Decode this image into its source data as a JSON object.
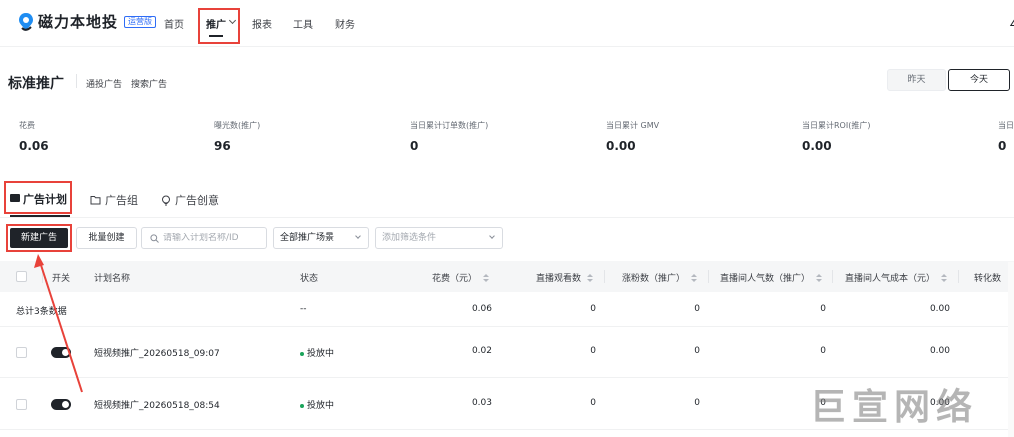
{
  "app": {
    "logo_text": "磁力本地投",
    "logo_badge": "运营版",
    "brand_color": "#1f8df2"
  },
  "nav": {
    "items": [
      {
        "label": "首页"
      },
      {
        "label": "推广",
        "active": true
      },
      {
        "label": "报表"
      },
      {
        "label": "工具"
      },
      {
        "label": "财务"
      }
    ],
    "edge_glyph": "∠"
  },
  "page": {
    "title": "标准推广",
    "sub_links": [
      "通投广告",
      "搜索广告"
    ],
    "day_buttons": {
      "yesterday": "昨天",
      "today": "今天",
      "selected": "今天"
    }
  },
  "metrics": [
    {
      "label": "花费",
      "value": "0.06"
    },
    {
      "label": "曝光数(推广)",
      "value": "96"
    },
    {
      "label": "当日累计订单数(推广)",
      "value": "0"
    },
    {
      "label": "当日累计 GMV",
      "value": "0.00"
    },
    {
      "label": "当日累计ROI(推广)",
      "value": "0.00"
    },
    {
      "label": "当日",
      "value": "0"
    }
  ],
  "tabs": [
    {
      "label": "广告计划",
      "icon": "folder-filled-icon",
      "active": true
    },
    {
      "label": "广告组",
      "icon": "folder-outline-icon"
    },
    {
      "label": "广告创意",
      "icon": "bulb-icon"
    }
  ],
  "toolbar": {
    "new_button": "新建广告",
    "batch_button": "批量创建",
    "search_placeholder": "请输入计划名称/ID",
    "scene_select": "全部推广场景",
    "filter_select_placeholder": "添加筛选条件"
  },
  "table": {
    "columns": [
      "开关",
      "计划名称",
      "状态",
      "花费（元）",
      "直播观看数",
      "涨粉数（推广）",
      "直播间人气数（推广）",
      "直播间人气成本（元）",
      "转化数"
    ],
    "summary": {
      "label": "总计3条数据",
      "status": "--",
      "spend": "0.06",
      "views": "0",
      "fans": "0",
      "popularity": "0",
      "popularity_cost": "0.00"
    },
    "rows": [
      {
        "name": "短视频推广_20260518_09:07",
        "status": "投放中",
        "spend": "0.02",
        "views": "0",
        "fans": "0",
        "popularity": "0",
        "popularity_cost": "0.00",
        "enabled": true
      },
      {
        "name": "短视频推广_20260518_08:54",
        "status": "投放中",
        "spend": "0.03",
        "views": "0",
        "fans": "0",
        "popularity": "0",
        "popularity_cost": "0.00",
        "enabled": true
      }
    ],
    "status_color": "#1aa35a"
  },
  "watermark": "巨宣网络",
  "highlight_color": "#e8423a"
}
